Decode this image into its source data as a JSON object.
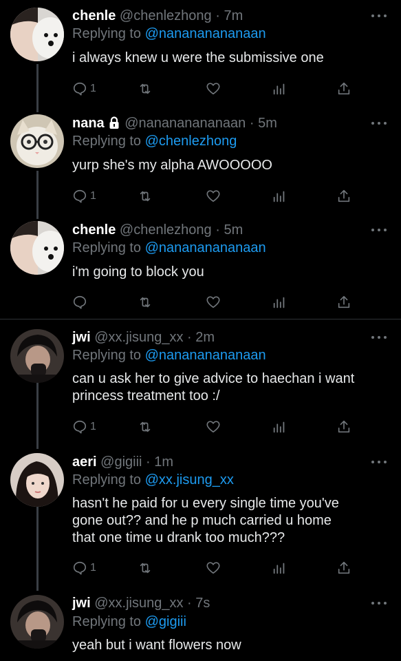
{
  "tweets": [
    {
      "name": "chenle",
      "handle": "@chenlezhong",
      "time": "7m",
      "replying_prefix": "Replying to",
      "replying_to": "@nanananananaan",
      "text": "i always knew u were the submissive one",
      "reply_count": "1",
      "avatar": "white-puppy-avatar",
      "locked": false
    },
    {
      "name": "nana",
      "handle": "@nanananananaan",
      "time": "5m",
      "replying_prefix": "Replying to",
      "replying_to": "@chenlezhong",
      "text": "yurp she's my alpha AWOOOOO",
      "reply_count": "1",
      "avatar": "cat-with-glasses-avatar",
      "locked": true
    },
    {
      "name": "chenle",
      "handle": "@chenlezhong",
      "time": "5m",
      "replying_prefix": "Replying to",
      "replying_to": "@nanananananaan",
      "text": "i'm going to block you",
      "reply_count": "",
      "avatar": "white-puppy-avatar",
      "locked": false
    },
    {
      "name": "jwi",
      "handle": "@xx.jisung_xx",
      "time": "2m",
      "replying_prefix": "Replying to",
      "replying_to": "@nanananananaan",
      "text_lines": [
        "can u ask her to give advice to haechan i want",
        "princess treatment too :/"
      ],
      "reply_count": "1",
      "avatar": "dark-hair-person-avatar",
      "locked": false
    },
    {
      "name": "aeri",
      "handle": "@gigiii",
      "time": "1m",
      "replying_prefix": "Replying to",
      "replying_to": "@xx.jisung_xx",
      "text_lines": [
        "hasn't he paid for u every single time you've",
        "gone out?? and he p much carried u home",
        "that one time u drank too much???"
      ],
      "reply_count": "1",
      "avatar": "woman-portrait-avatar",
      "locked": false
    },
    {
      "name": "jwi",
      "handle": "@xx.jisung_xx",
      "time": "7s",
      "replying_prefix": "Replying to",
      "replying_to": "@gigiii",
      "text": "yeah but i want flowers now",
      "avatar": "dark-hair-person-avatar",
      "locked": false
    }
  ],
  "separator": "·",
  "colors": {
    "background": "#000000",
    "muted": "#71767b",
    "accent": "#1d9bf0",
    "text": "#e7e9ea"
  }
}
